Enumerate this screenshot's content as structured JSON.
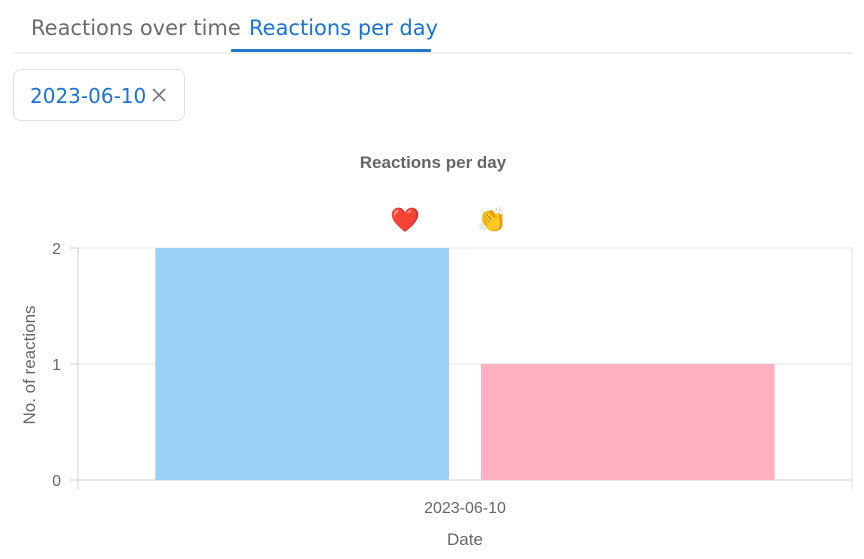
{
  "tabs": [
    {
      "label": "Reactions over time",
      "active": false
    },
    {
      "label": "Reactions per day",
      "active": true
    }
  ],
  "filter_chip": {
    "label": "2023-06-10",
    "close_icon": "close-icon"
  },
  "colors": {
    "accent": "#1a73d4",
    "bar_1": "#9ad0f5",
    "bar_2": "#ffb1c1"
  },
  "chart_data": {
    "type": "bar",
    "title": "Reactions per day",
    "xlabel": "Date",
    "ylabel": "No. of reactions",
    "categories": [
      "2023-06-10"
    ],
    "series": [
      {
        "legend_icon": "heart-emoji",
        "glyph": "❤️",
        "values": [
          2
        ],
        "color": "#9ad0f5"
      },
      {
        "legend_icon": "clapping-hands-emoji",
        "glyph": "👏",
        "values": [
          1
        ],
        "color": "#ffb1c1"
      }
    ],
    "ylim": [
      0,
      2
    ],
    "yticks": [
      0,
      1,
      2
    ],
    "grid": true,
    "legend_position": "top"
  }
}
